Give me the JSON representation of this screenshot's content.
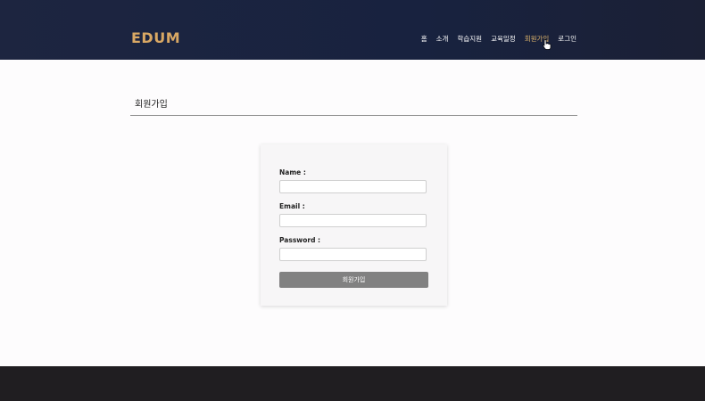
{
  "header": {
    "logo": "EDUM",
    "nav": [
      {
        "label": "홈",
        "active": false
      },
      {
        "label": "소개",
        "active": false
      },
      {
        "label": "학습지원",
        "active": false
      },
      {
        "label": "교육일정",
        "active": false
      },
      {
        "label": "회원가입",
        "active": true
      },
      {
        "label": "로그인",
        "active": false
      }
    ]
  },
  "main": {
    "title": "회원가입",
    "form": {
      "fields": [
        {
          "label": "Name :",
          "value": "",
          "placeholder": ""
        },
        {
          "label": "Email :",
          "value": "",
          "placeholder": ""
        },
        {
          "label": "Password :",
          "value": "",
          "placeholder": ""
        }
      ],
      "submit_label": "회원가입"
    }
  },
  "colors": {
    "header_bg": "#1b2440",
    "logo": "#d9a864",
    "nav_active": "#e0b56c",
    "button": "#818181",
    "footer_bg": "#201e21"
  }
}
